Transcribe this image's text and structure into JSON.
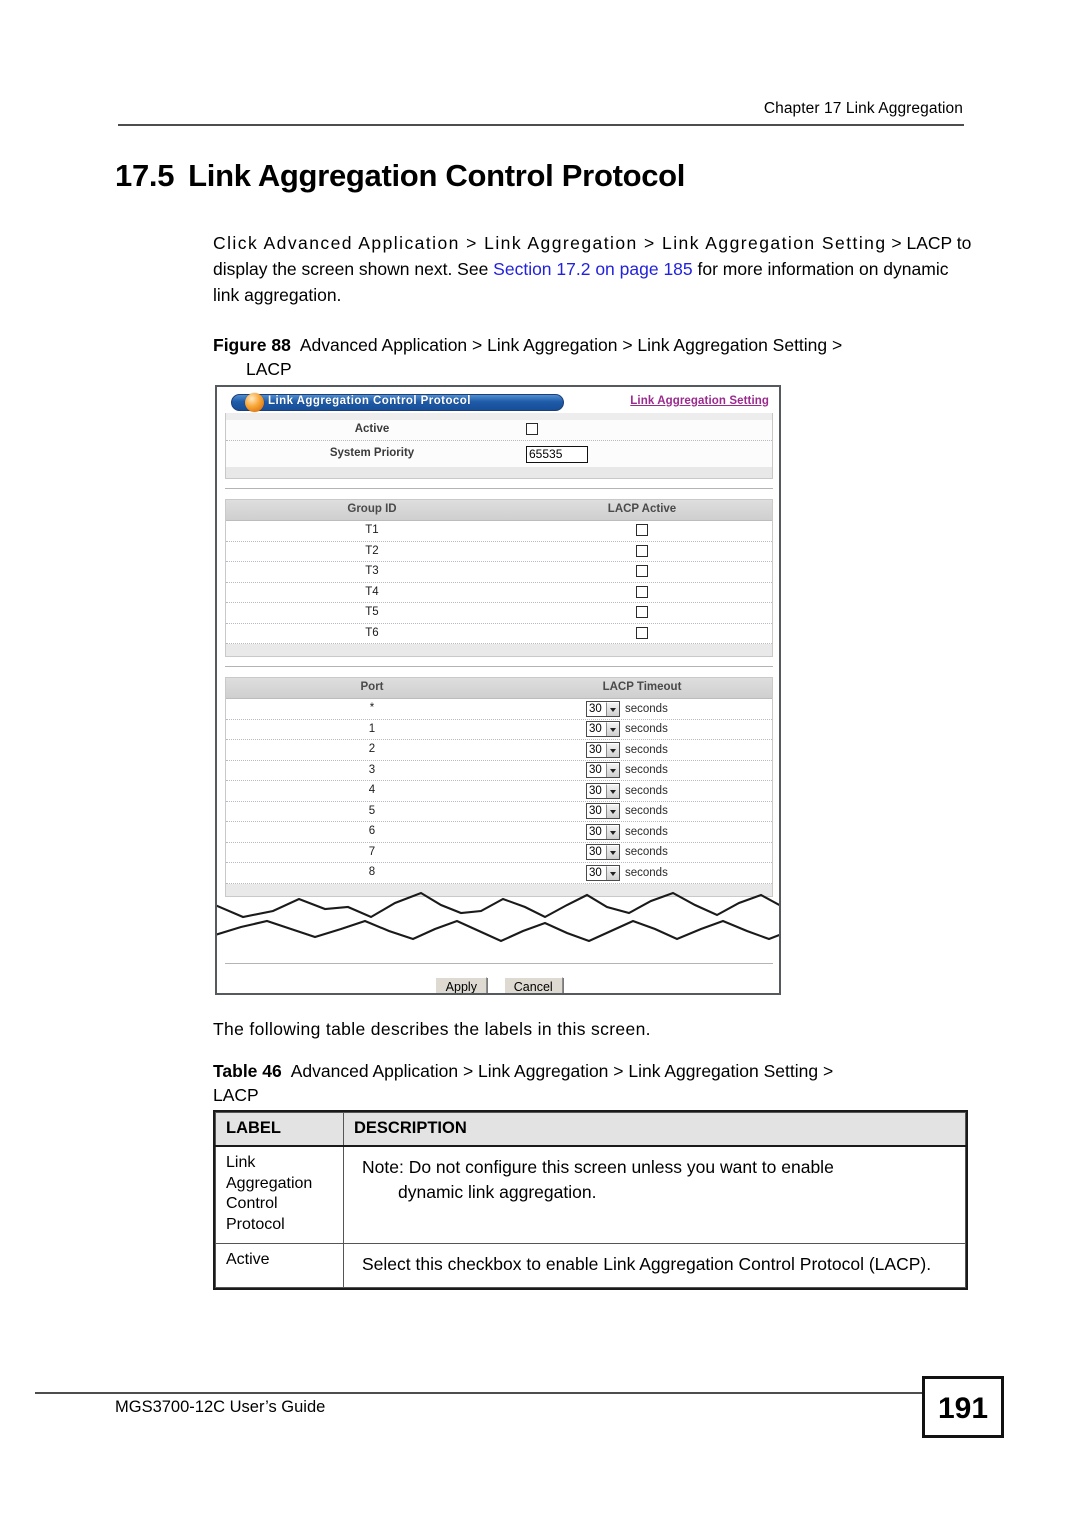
{
  "header": {
    "running_head": "Chapter 17 Link Aggregation"
  },
  "section": {
    "number": "17.5",
    "title": "Link Aggregation Control Protocol"
  },
  "intro": {
    "part1": "Click Advanced Application > Link Aggregation > Link Aggregation Setting",
    "part2": "> LACP to display the screen shown next. See ",
    "link": "Section 17.2 on page 185",
    "part3": " for more information on dynamic link aggregation."
  },
  "figure": {
    "label": "Figure 88",
    "caption": "Advanced Application > Link Aggregation > Link Aggregation Setting >",
    "caption_cont": "LACP"
  },
  "screen": {
    "title": "Link Aggregation Control Protocol",
    "setting_link": "Link Aggregation Setting",
    "fields": [
      {
        "label": "Active",
        "type": "checkbox",
        "value": ""
      },
      {
        "label": "System Priority",
        "type": "text",
        "value": "65535"
      }
    ],
    "group_table": {
      "headers": [
        "Group ID",
        "LACP Active"
      ],
      "rows": [
        "T1",
        "T2",
        "T3",
        "T4",
        "T5",
        "T6"
      ]
    },
    "port_table": {
      "headers": [
        "Port",
        "LACP Timeout"
      ],
      "unit": "seconds",
      "timeout_value": "30",
      "rows": [
        "*",
        "1",
        "2",
        "3",
        "4",
        "5",
        "6",
        "7",
        "8"
      ]
    },
    "buttons": {
      "apply": "Apply",
      "cancel": "Cancel"
    }
  },
  "after_figure": "The following table describes the labels in this screen.",
  "table_caption": {
    "label": "Table 46",
    "caption": "Advanced Application > Link Aggregation > Link Aggregation Setting >",
    "caption_cont": "LACP"
  },
  "desc_table": {
    "headers": [
      "LABEL",
      "DESCRIPTION"
    ],
    "rows": [
      {
        "label": "Link Aggregation Control Protocol",
        "description": "Note: Do not configure this screen unless you want to enable",
        "description_cont": "dynamic link aggregation."
      },
      {
        "label": "Active",
        "description": "Select this checkbox to enable Link Aggregation Control Protocol (LACP).",
        "description_cont": ""
      }
    ]
  },
  "footer": {
    "guide": "MGS3700-12C User’s Guide",
    "page": "191"
  },
  "colors": {
    "xref_link": "#2222dd",
    "screen_link": "#9b2a8e",
    "titlebar_blue": "#1f5ba8",
    "ball_orange": "#f9a93b"
  }
}
